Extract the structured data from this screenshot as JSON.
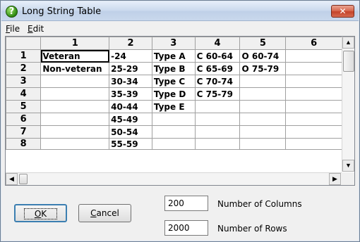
{
  "window": {
    "title": "Long String Table",
    "help_icon_glyph": "?",
    "close_glyph": "✕"
  },
  "menu": {
    "file": {
      "accel": "F",
      "rest": "ile"
    },
    "edit": {
      "accel": "E",
      "rest": "dit"
    }
  },
  "grid": {
    "columns": [
      "1",
      "2",
      "3",
      "4",
      "5",
      "6"
    ],
    "rows": [
      {
        "num": "1",
        "cells": [
          "Veteran",
          "-24",
          "Type A",
          "C 60-64",
          "O 60-74",
          ""
        ]
      },
      {
        "num": "2",
        "cells": [
          "Non-veteran",
          "25-29",
          "Type B",
          "C 65-69",
          "O 75-79",
          ""
        ]
      },
      {
        "num": "3",
        "cells": [
          "",
          "30-34",
          "Type C",
          "C 70-74",
          "",
          ""
        ]
      },
      {
        "num": "4",
        "cells": [
          "",
          "35-39",
          "Type D",
          "C 75-79",
          "",
          ""
        ]
      },
      {
        "num": "5",
        "cells": [
          "",
          "40-44",
          "Type E",
          "",
          "",
          ""
        ]
      },
      {
        "num": "6",
        "cells": [
          "",
          "45-49",
          "",
          "",
          "",
          ""
        ]
      },
      {
        "num": "7",
        "cells": [
          "",
          "50-54",
          "",
          "",
          "",
          ""
        ]
      },
      {
        "num": "8",
        "cells": [
          "",
          "55-59",
          "",
          "",
          "",
          ""
        ]
      }
    ]
  },
  "scroll": {
    "up": "▲",
    "down": "▼",
    "left": "◀",
    "right": "▶"
  },
  "buttons": {
    "ok": {
      "accel": "O",
      "rest": "K"
    },
    "cancel": {
      "accel": "C",
      "rest": "ancel"
    }
  },
  "fields": {
    "columns_value": "200",
    "columns_label": "Number of Columns",
    "rows_value": "2000",
    "rows_label": "Number of Rows"
  }
}
